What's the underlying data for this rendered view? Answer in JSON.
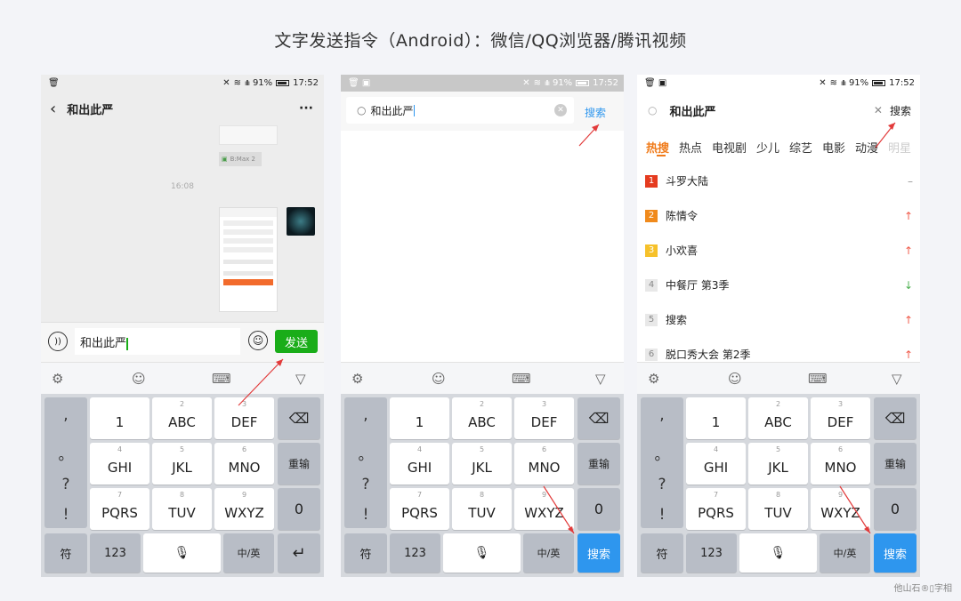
{
  "title": "文字发送指令（Android）：微信/QQ浏览器/腾讯视频",
  "watermark": "他山石®▯字相",
  "status": {
    "battery": "91%",
    "time": "17:52"
  },
  "keyboard": {
    "punct": [
      ",",
      "。",
      "?",
      "!"
    ],
    "rows": [
      [
        {
          "num": "",
          "label": "1"
        },
        {
          "num": "2",
          "label": "ABC"
        },
        {
          "num": "3",
          "label": "DEF"
        }
      ],
      [
        {
          "num": "4",
          "label": "GHI"
        },
        {
          "num": "5",
          "label": "JKL"
        },
        {
          "num": "6",
          "label": "MNO"
        }
      ],
      [
        {
          "num": "7",
          "label": "PQRS"
        },
        {
          "num": "8",
          "label": "TUV"
        },
        {
          "num": "9",
          "label": "WXYZ"
        }
      ]
    ],
    "delete_icon": "backspace-icon",
    "reenter": "重输",
    "zero": "0",
    "sym": "符",
    "num123": "123",
    "lang": "中/英",
    "enter_icon": "return-icon",
    "search_key": "搜索"
  },
  "wechat": {
    "contact": "和出此严",
    "time_label": "16:08",
    "input_value": "和出此严",
    "send": "发送",
    "more": "···",
    "file_label": "B:Max 2"
  },
  "qq": {
    "input_value": "和出此严",
    "search": "搜索"
  },
  "video": {
    "input_value": "和出此严",
    "search": "搜索",
    "tabs": [
      "热搜",
      "热点",
      "电视剧",
      "少儿",
      "综艺",
      "电影",
      "动漫",
      "明星"
    ],
    "hot": [
      {
        "rank": "1",
        "title": "斗罗大陆",
        "trend": "–",
        "color": "#e53b1f",
        "trend_color": "#999"
      },
      {
        "rank": "2",
        "title": "陈情令",
        "trend": "↑",
        "color": "#f08a1c",
        "trend_color": "#f05a4a"
      },
      {
        "rank": "3",
        "title": "小欢喜",
        "trend": "↑",
        "color": "#f6c12a",
        "trend_color": "#f05a4a"
      },
      {
        "rank": "4",
        "title": "中餐厅 第3季",
        "trend": "↓",
        "color": "#e8e8e8",
        "trend_color": "#4cb050"
      },
      {
        "rank": "5",
        "title": "搜索",
        "trend": "↑",
        "color": "#e8e8e8",
        "trend_color": "#f05a4a"
      },
      {
        "rank": "6",
        "title": "脱口秀大会 第2季",
        "trend": "↑",
        "color": "#e8e8e8",
        "trend_color": "#f05a4a"
      }
    ]
  }
}
